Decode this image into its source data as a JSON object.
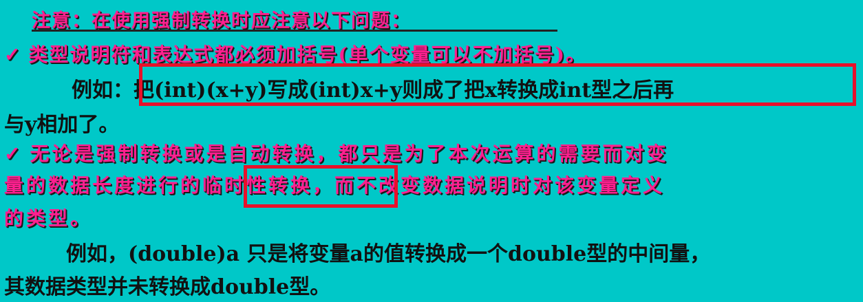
{
  "slide": {
    "heading": "注意：在使用强制转换时应注意以下问题：",
    "point1": {
      "check": "✓",
      "text": "类型说明符和表达式都必须加括号(单个变量可以不加括号)。"
    },
    "example1": {
      "prefix": "例如：",
      "boxed": "把(int)(x+y)写成(int)x+y则成了把x转换成int型之后再",
      "continuation": "与y相加了。"
    },
    "point2": {
      "check": "✓",
      "line1": "无论是强制转换或是自动转换，都只是为了本次运算的需要而对变",
      "line2_before": "量的数据长度进行的",
      "line2_boxed": "临时性转换",
      "line2_after": "，而不改变数据说明时对该变量定义",
      "line3": "的类型。"
    },
    "example2": {
      "line1": "例如，(double)a 只是将变量a的值转换成一个double型的中间量，",
      "line2": "其数据类型并未转换成double型。"
    },
    "colors": {
      "background": "#00c8c8",
      "emphasis_text": "#ff1f8f",
      "body_text": "#111111",
      "highlight_box": "#e8102a"
    }
  }
}
